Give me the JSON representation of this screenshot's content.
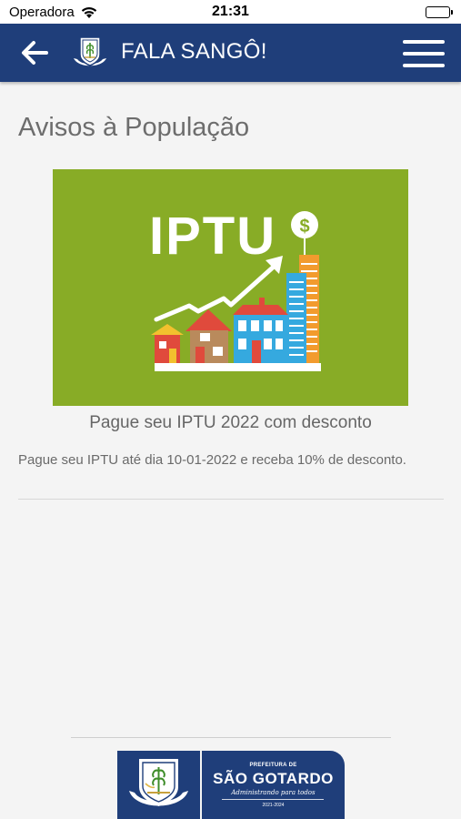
{
  "status_bar": {
    "carrier": "Operadora",
    "time": "21:31"
  },
  "header": {
    "back_icon": "arrow-left-icon",
    "logo_icon": "crest-icon",
    "title": "FALA SANGÔ!",
    "menu_icon": "hamburger-menu-icon",
    "background_color": "#1f3e7a"
  },
  "page": {
    "title": "Avisos à População"
  },
  "notice": {
    "image_text": "IPTU",
    "image_background_color": "#88ac26",
    "title": "Pague seu IPTU 2022 com desconto",
    "description": "Pague seu IPTU até dia 10-01-2022 e receba 10% de desconto."
  },
  "footer": {
    "prefeitura_label": "PREFEITURA DE",
    "city_name": "SÃO GOTARDO",
    "slogan": "Administrando para todos",
    "term": "2021-2024"
  }
}
